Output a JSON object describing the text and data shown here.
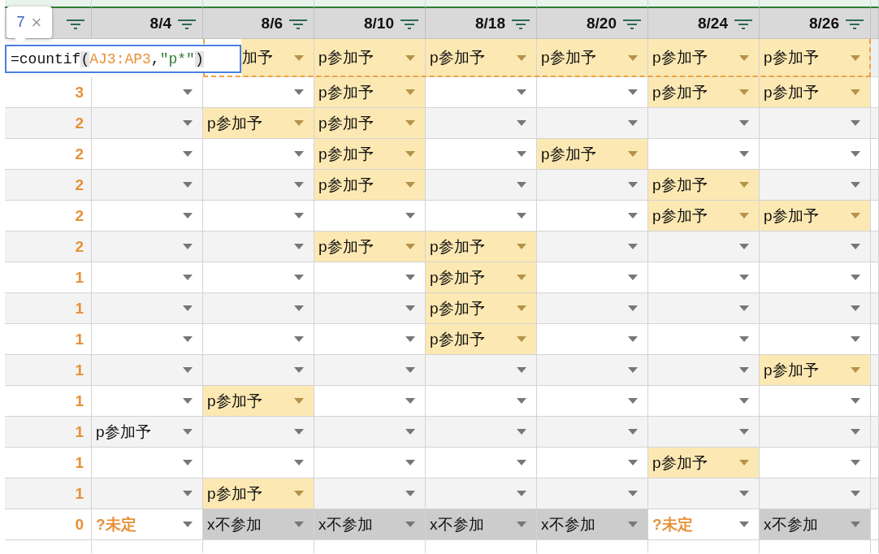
{
  "tooltip": {
    "value": "7",
    "close": "×"
  },
  "formula_editor": {
    "segments": [
      {
        "text": "=countif",
        "kind": "plain"
      },
      {
        "text": "(",
        "kind": "paren"
      },
      {
        "text": "AJ3:AP3",
        "kind": "range"
      },
      {
        "text": ",",
        "kind": "plain"
      },
      {
        "text": "\"p*\"",
        "kind": "string"
      },
      {
        "text": ")",
        "kind": "paren"
      }
    ]
  },
  "columns": [
    "8/4",
    "8/6",
    "8/10",
    "8/18",
    "8/20",
    "8/24",
    "8/26"
  ],
  "rows": [
    {
      "copied": true,
      "cells": [
        {
          "kind": "hidden"
        },
        {
          "kind": "p",
          "value": "加予",
          "covered": true
        },
        {
          "kind": "p",
          "value": "p参加予"
        },
        {
          "kind": "p",
          "value": "p参加予"
        },
        {
          "kind": "p",
          "value": "p参加予"
        },
        {
          "kind": "p",
          "value": "p参加予"
        },
        {
          "kind": "p",
          "value": "p参加予"
        }
      ]
    },
    {
      "count": "3",
      "cells": [
        {
          "kind": "empty"
        },
        {
          "kind": "empty"
        },
        {
          "kind": "p",
          "value": "p参加予"
        },
        {
          "kind": "empty"
        },
        {
          "kind": "empty"
        },
        {
          "kind": "p",
          "value": "p参加予"
        },
        {
          "kind": "p",
          "value": "p参加予"
        }
      ]
    },
    {
      "count": "2",
      "cells": [
        {
          "kind": "empty"
        },
        {
          "kind": "p",
          "value": "p参加予"
        },
        {
          "kind": "p",
          "value": "p参加予"
        },
        {
          "kind": "empty"
        },
        {
          "kind": "empty"
        },
        {
          "kind": "empty"
        },
        {
          "kind": "empty"
        }
      ]
    },
    {
      "count": "2",
      "cells": [
        {
          "kind": "empty"
        },
        {
          "kind": "empty"
        },
        {
          "kind": "p",
          "value": "p参加予"
        },
        {
          "kind": "empty"
        },
        {
          "kind": "p",
          "value": "p参加予"
        },
        {
          "kind": "empty"
        },
        {
          "kind": "empty"
        }
      ]
    },
    {
      "count": "2",
      "cells": [
        {
          "kind": "empty"
        },
        {
          "kind": "empty"
        },
        {
          "kind": "p",
          "value": "p参加予"
        },
        {
          "kind": "empty"
        },
        {
          "kind": "empty"
        },
        {
          "kind": "p",
          "value": "p参加予"
        },
        {
          "kind": "empty"
        }
      ]
    },
    {
      "count": "2",
      "cells": [
        {
          "kind": "empty"
        },
        {
          "kind": "empty"
        },
        {
          "kind": "empty"
        },
        {
          "kind": "empty"
        },
        {
          "kind": "empty"
        },
        {
          "kind": "p",
          "value": "p参加予"
        },
        {
          "kind": "p",
          "value": "p参加予"
        }
      ]
    },
    {
      "count": "2",
      "cells": [
        {
          "kind": "empty"
        },
        {
          "kind": "empty"
        },
        {
          "kind": "p",
          "value": "p参加予"
        },
        {
          "kind": "p",
          "value": "p参加予"
        },
        {
          "kind": "empty"
        },
        {
          "kind": "empty"
        },
        {
          "kind": "empty"
        }
      ]
    },
    {
      "count": "1",
      "cells": [
        {
          "kind": "empty"
        },
        {
          "kind": "empty"
        },
        {
          "kind": "empty"
        },
        {
          "kind": "p",
          "value": "p参加予"
        },
        {
          "kind": "empty"
        },
        {
          "kind": "empty"
        },
        {
          "kind": "empty"
        }
      ]
    },
    {
      "count": "1",
      "cells": [
        {
          "kind": "empty"
        },
        {
          "kind": "empty"
        },
        {
          "kind": "empty"
        },
        {
          "kind": "p",
          "value": "p参加予"
        },
        {
          "kind": "empty"
        },
        {
          "kind": "empty"
        },
        {
          "kind": "empty"
        }
      ]
    },
    {
      "count": "1",
      "cells": [
        {
          "kind": "empty"
        },
        {
          "kind": "empty"
        },
        {
          "kind": "empty"
        },
        {
          "kind": "p",
          "value": "p参加予"
        },
        {
          "kind": "empty"
        },
        {
          "kind": "empty"
        },
        {
          "kind": "empty"
        }
      ]
    },
    {
      "count": "1",
      "cells": [
        {
          "kind": "empty"
        },
        {
          "kind": "empty"
        },
        {
          "kind": "empty"
        },
        {
          "kind": "empty"
        },
        {
          "kind": "empty"
        },
        {
          "kind": "empty"
        },
        {
          "kind": "p",
          "value": "p参加予"
        }
      ]
    },
    {
      "count": "1",
      "cells": [
        {
          "kind": "empty"
        },
        {
          "kind": "p",
          "value": "p参加予"
        },
        {
          "kind": "empty"
        },
        {
          "kind": "empty"
        },
        {
          "kind": "empty"
        },
        {
          "kind": "empty"
        },
        {
          "kind": "empty"
        }
      ]
    },
    {
      "count": "1",
      "cells": [
        {
          "kind": "text",
          "value": "p参加予"
        },
        {
          "kind": "empty"
        },
        {
          "kind": "empty"
        },
        {
          "kind": "empty"
        },
        {
          "kind": "empty"
        },
        {
          "kind": "empty"
        },
        {
          "kind": "empty"
        }
      ]
    },
    {
      "count": "1",
      "cells": [
        {
          "kind": "empty"
        },
        {
          "kind": "empty"
        },
        {
          "kind": "empty"
        },
        {
          "kind": "empty"
        },
        {
          "kind": "empty"
        },
        {
          "kind": "p",
          "value": "p参加予"
        },
        {
          "kind": "empty"
        }
      ]
    },
    {
      "count": "1",
      "cells": [
        {
          "kind": "empty"
        },
        {
          "kind": "p",
          "value": "p参加予"
        },
        {
          "kind": "empty"
        },
        {
          "kind": "empty"
        },
        {
          "kind": "empty"
        },
        {
          "kind": "empty"
        },
        {
          "kind": "empty"
        }
      ]
    },
    {
      "count": "0",
      "cells": [
        {
          "kind": "q",
          "value": "?未定"
        },
        {
          "kind": "x",
          "value": "x不参加"
        },
        {
          "kind": "x",
          "value": "x不参加"
        },
        {
          "kind": "x",
          "value": "x不参加"
        },
        {
          "kind": "x",
          "value": "x不参加"
        },
        {
          "kind": "q",
          "value": "?未定"
        },
        {
          "kind": "x",
          "value": "x不参加"
        }
      ]
    }
  ]
}
